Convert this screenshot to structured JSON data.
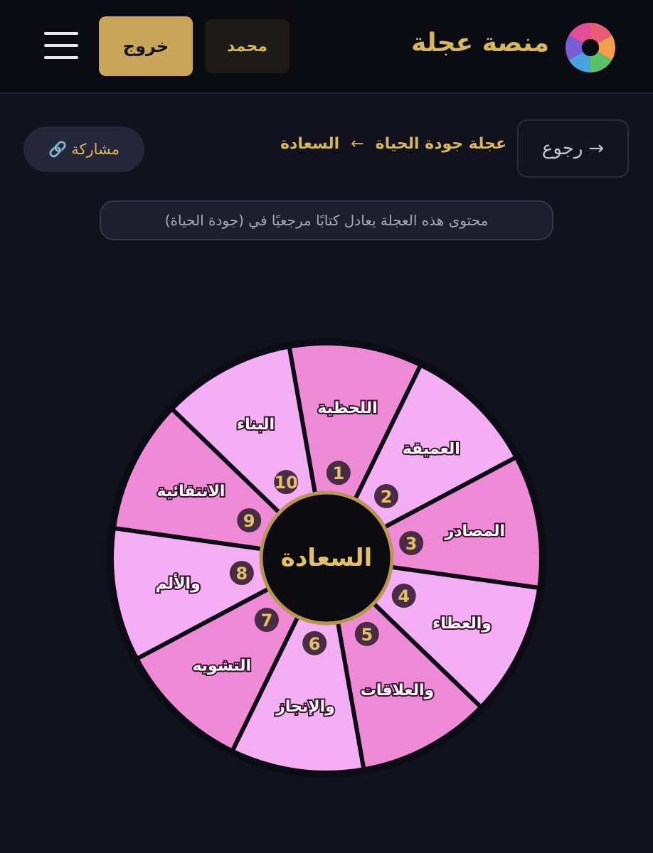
{
  "header": {
    "brand": "منصة عجلة",
    "user_label": "محمد",
    "logout_label": "خروج",
    "logo_colors": [
      "#e85d75",
      "#f0a04b",
      "#5bc06a",
      "#4aa3df",
      "#7a5cd6",
      "#e44d9a"
    ],
    "menu_icon": "hamburger-menu-icon"
  },
  "nav": {
    "back_label": "رجوع",
    "back_arrow": "→",
    "breadcrumb": [
      "عجلة جودة الحياة",
      "السعادة"
    ],
    "breadcrumb_sep": "←",
    "share_label": "مشاركة",
    "share_icon": "🔗"
  },
  "info": {
    "text": "محتوى هذه العجلة يعادل كتابًا مرجعيًا في (جودة الحياة)"
  },
  "wheel": {
    "center_label": "السعادة",
    "segments": [
      {
        "number": "1",
        "label": "اللحظية"
      },
      {
        "number": "2",
        "label": "العميقة"
      },
      {
        "number": "3",
        "label": "المصادر"
      },
      {
        "number": "4",
        "label": "والعطاء"
      },
      {
        "number": "5",
        "label": "والعلاقات"
      },
      {
        "number": "6",
        "label": "والإنجاز"
      },
      {
        "number": "7",
        "label": "التشويه"
      },
      {
        "number": "8",
        "label": "والألم"
      },
      {
        "number": "9",
        "label": "الانتقائية"
      },
      {
        "number": "10",
        "label": "البناء"
      }
    ],
    "colors": {
      "segment_dark": "#ee8ad6",
      "segment_light": "#f3aef4",
      "divider": "#0c0c14",
      "badge_fill": "#4a2b45",
      "badge_text": "#e2c06a",
      "hub_fill": "#0b0b10",
      "hub_ring": "#b99652"
    }
  }
}
